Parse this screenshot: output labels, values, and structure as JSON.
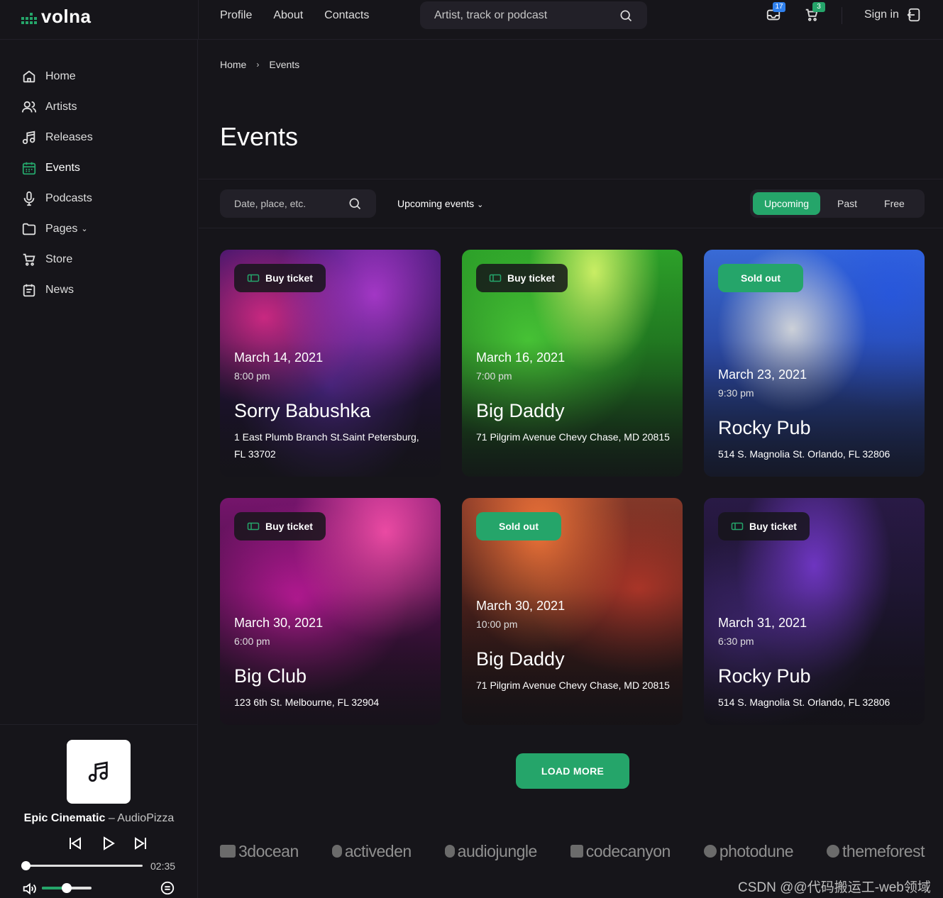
{
  "brand": {
    "name": "volna",
    "accent": "#25a56a"
  },
  "header": {
    "nav": [
      "Profile",
      "About",
      "Contacts"
    ],
    "search_placeholder": "Artist, track or podcast",
    "mail_badge": "17",
    "cart_badge": "3",
    "signin_label": "Sign in"
  },
  "sidebar": {
    "items": [
      {
        "label": "Home",
        "icon": "home-icon"
      },
      {
        "label": "Artists",
        "icon": "users-icon"
      },
      {
        "label": "Releases",
        "icon": "music-note-icon"
      },
      {
        "label": "Events",
        "icon": "calendar-icon",
        "active": true
      },
      {
        "label": "Podcasts",
        "icon": "microphone-icon"
      },
      {
        "label": "Pages",
        "icon": "folder-icon"
      },
      {
        "label": "Store",
        "icon": "cart-icon"
      },
      {
        "label": "News",
        "icon": "calendar-notes-icon"
      }
    ],
    "pages_chevron": "⌄"
  },
  "player": {
    "title": "Epic Cinematic",
    "separator": "–",
    "artist": "AudioPizza",
    "time": "02:35",
    "progress": 0.02,
    "volume": 0.5
  },
  "breadcrumb": {
    "home": "Home",
    "sep": "›",
    "current": "Events"
  },
  "page_title": "Events",
  "filters": {
    "search_placeholder": "Date, place, etc.",
    "dropdown_label": "Upcoming events",
    "dropdown_chevron": "⌄",
    "tabs": [
      "Upcoming",
      "Past",
      "Free"
    ]
  },
  "events": [
    {
      "status": "Buy ticket",
      "date": "March 14, 2021",
      "time": "8:00 pm",
      "name": "Sorry Babushka",
      "address": "1 East Plumb Branch St.Saint Petersburg, FL 33702"
    },
    {
      "status": "Buy ticket",
      "date": "March 16, 2021",
      "time": "7:00 pm",
      "name": "Big Daddy",
      "address": "71 Pilgrim Avenue Chevy Chase, MD 20815"
    },
    {
      "status": "Sold out",
      "date": "March 23, 2021",
      "time": "9:30 pm",
      "name": "Rocky Pub",
      "address": "514 S. Magnolia St. Orlando, FL 32806"
    },
    {
      "status": "Buy ticket",
      "date": "March 30, 2021",
      "time": "6:00 pm",
      "name": "Big Club",
      "address": "123 6th St. Melbourne, FL 32904"
    },
    {
      "status": "Sold out",
      "date": "March 30, 2021",
      "time": "10:00 pm",
      "name": "Big Daddy",
      "address": "71 Pilgrim Avenue Chevy Chase, MD 20815"
    },
    {
      "status": "Buy ticket",
      "date": "March 31, 2021",
      "time": "6:30 pm",
      "name": "Rocky Pub",
      "address": "514 S. Magnolia St. Orlando, FL 32806"
    }
  ],
  "load_more": "LOAD MORE",
  "partners": [
    "3docean",
    "activeden",
    "audiojungle",
    "codecanyon",
    "photodune",
    "themeforest"
  ],
  "watermark": "CSDN @@代码搬运工-web领域"
}
